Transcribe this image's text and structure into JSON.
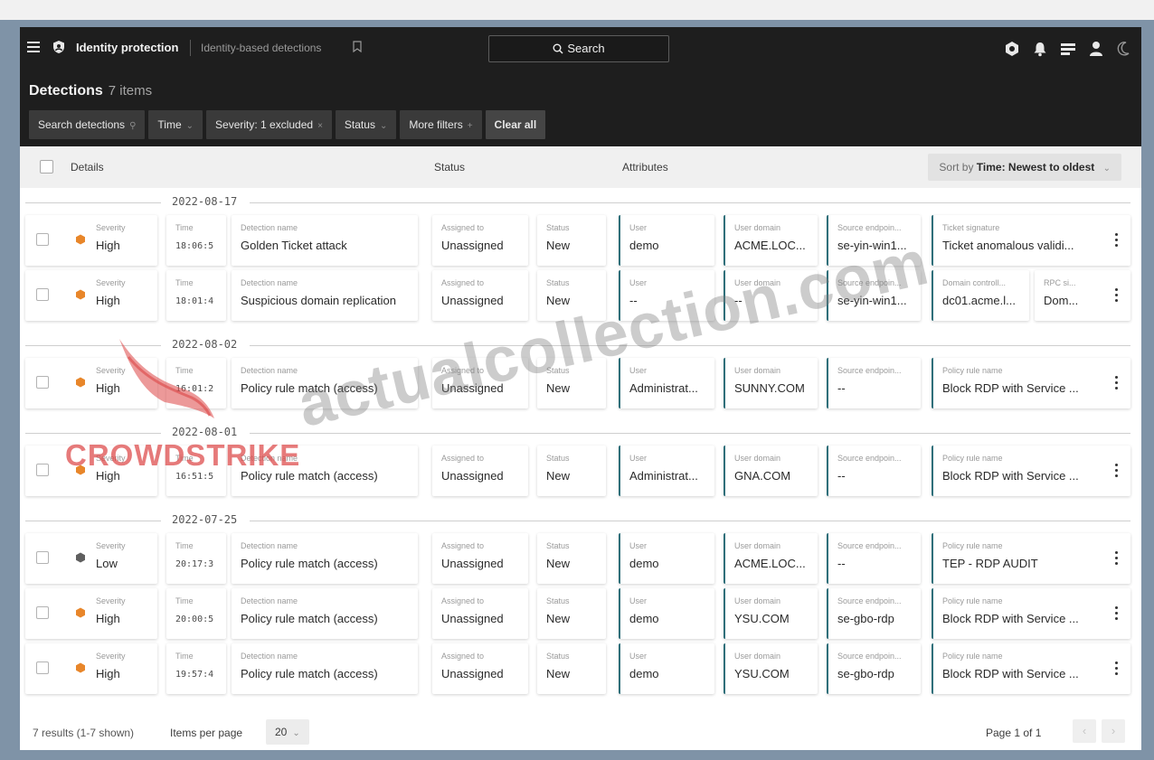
{
  "header": {
    "product": "Identity protection",
    "page": "Identity-based detections",
    "search_label": "Search"
  },
  "title": {
    "label": "Detections",
    "count": "7 items"
  },
  "filters": [
    {
      "label": "Search detections",
      "suffix": "⚲"
    },
    {
      "label": "Time",
      "suffix": "⌄"
    },
    {
      "label": "Severity: 1 excluded",
      "suffix": "×"
    },
    {
      "label": "Status",
      "suffix": "⌄"
    },
    {
      "label": "More filters",
      "suffix": "+"
    },
    {
      "label": "Clear all",
      "suffix": ""
    }
  ],
  "columns": {
    "details": "Details",
    "status": "Status",
    "attributes": "Attributes"
  },
  "sort": {
    "prefix": "Sort by",
    "value": "Time: Newest to oldest",
    "suffix": "⌄"
  },
  "labels": {
    "severity": "Severity",
    "time": "Time",
    "detection_name": "Detection name",
    "assigned_to": "Assigned to",
    "status": "Status",
    "user": "User",
    "user_domain": "User domain",
    "source_endpoint": "Source endpoin...",
    "ticket_signature": "Ticket signature",
    "policy_rule_name": "Policy rule name",
    "domain_controller": "Domain controll...",
    "rpc": "RPC si..."
  },
  "groups": [
    {
      "date": "2022-08-17",
      "rows": [
        {
          "severity": "High",
          "sev_color": "#e8862a",
          "time": "18:06:5",
          "name": "Golden Ticket attack",
          "assigned": "Unassigned",
          "status": "New",
          "user": "demo",
          "domain": "ACME.LOC...",
          "source": "se-yin-win1...",
          "extra_label": "Ticket signature",
          "extra": "Ticket anomalous validi..."
        },
        {
          "severity": "High",
          "sev_color": "#e8862a",
          "time": "18:01:4",
          "name": "Suspicious domain replication",
          "assigned": "Unassigned",
          "status": "New",
          "user": "--",
          "domain": "--",
          "source": "se-yin-win1...",
          "extra_label": "Domain controll...",
          "extra": "dc01.acme.l...",
          "extra2_label": "RPC si...",
          "extra2": "Dom..."
        }
      ]
    },
    {
      "date": "2022-08-02",
      "rows": [
        {
          "severity": "High",
          "sev_color": "#e8862a",
          "time": "16:01:2",
          "name": "Policy rule match (access)",
          "assigned": "Unassigned",
          "status": "New",
          "user": "Administrat...",
          "domain": "SUNNY.COM",
          "source": "--",
          "extra_label": "Policy rule name",
          "extra": "Block RDP with Service ..."
        }
      ]
    },
    {
      "date": "2022-08-01",
      "rows": [
        {
          "severity": "High",
          "sev_color": "#e8862a",
          "time": "16:51:5",
          "name": "Policy rule match (access)",
          "assigned": "Unassigned",
          "status": "New",
          "user": "Administrat...",
          "domain": "GNA.COM",
          "source": "--",
          "extra_label": "Policy rule name",
          "extra": "Block RDP with Service ..."
        }
      ]
    },
    {
      "date": "2022-07-25",
      "rows": [
        {
          "severity": "Low",
          "sev_color": "#5f5f5f",
          "time": "20:17:3",
          "name": "Policy rule match (access)",
          "assigned": "Unassigned",
          "status": "New",
          "user": "demo",
          "domain": "ACME.LOC...",
          "source": "--",
          "extra_label": "Policy rule name",
          "extra": "TEP - RDP AUDIT"
        },
        {
          "severity": "High",
          "sev_color": "#e8862a",
          "time": "20:00:5",
          "name": "Policy rule match (access)",
          "assigned": "Unassigned",
          "status": "New",
          "user": "demo",
          "domain": "YSU.COM",
          "source": "se-gbo-rdp",
          "extra_label": "Policy rule name",
          "extra": "Block RDP with Service ..."
        },
        {
          "severity": "High",
          "sev_color": "#e8862a",
          "time": "19:57:4",
          "name": "Policy rule match (access)",
          "assigned": "Unassigned",
          "status": "New",
          "user": "demo",
          "domain": "YSU.COM",
          "source": "se-gbo-rdp",
          "extra_label": "Policy rule name",
          "extra": "Block RDP with Service ..."
        }
      ]
    }
  ],
  "footer": {
    "results": "7 results (1-7 shown)",
    "items_per_page_label": "Items per page",
    "items_per_page": "20",
    "page": "Page 1 of 1"
  },
  "watermarks": {
    "site": "actualcollection.com",
    "logo": "CROWDSTRIKE"
  }
}
